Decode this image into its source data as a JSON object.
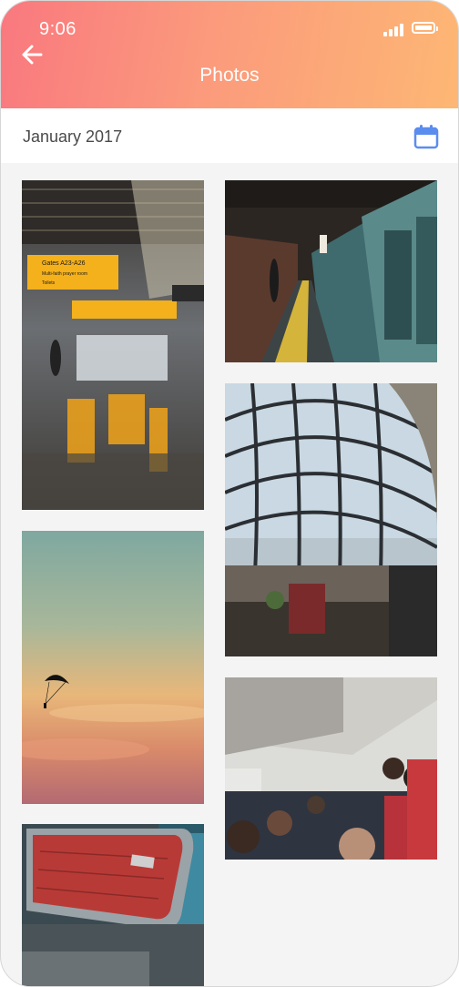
{
  "status_bar": {
    "time": "9:06"
  },
  "header": {
    "title": "Photos",
    "back_icon": "arrow-left-icon",
    "gradient": [
      "#f9787f",
      "#fdb774"
    ]
  },
  "date_bar": {
    "label": "January 2017",
    "calendar_icon": "calendar-icon",
    "accent_color": "#5b8def"
  },
  "gallery": {
    "photos": [
      {
        "name": "photo-airport-terminal",
        "sign_lines": [
          "Gates A23-A26",
          "Multi-faith prayer room",
          "Toilets"
        ]
      },
      {
        "name": "photo-subway-train"
      },
      {
        "name": "photo-glass-terminal"
      },
      {
        "name": "photo-paraglider-sunset"
      },
      {
        "name": "photo-airplane-cabin"
      },
      {
        "name": "photo-red-suitcase"
      }
    ]
  }
}
